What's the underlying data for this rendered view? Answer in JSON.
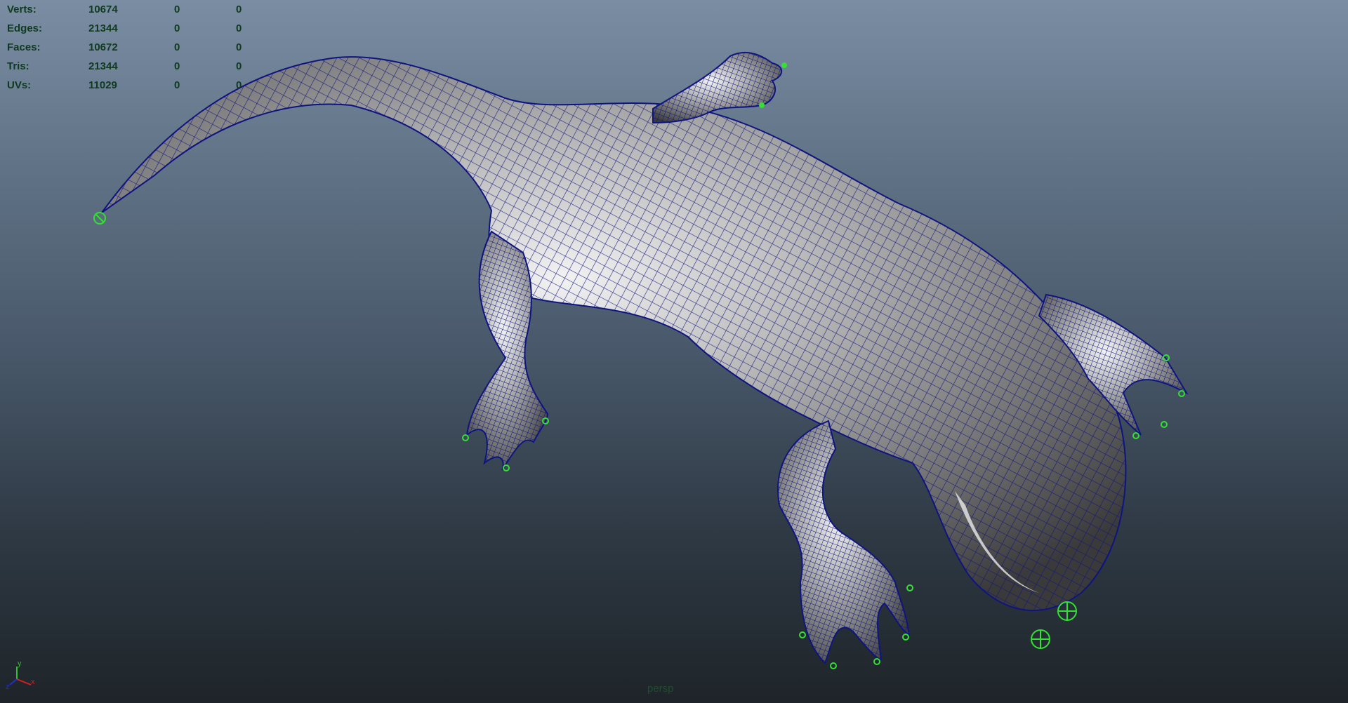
{
  "hud": {
    "rows": [
      {
        "label": "Verts:",
        "v1": "10674",
        "v2": "0",
        "v3": "0"
      },
      {
        "label": "Edges:",
        "v1": "21344",
        "v2": "0",
        "v3": "0"
      },
      {
        "label": "Faces:",
        "v1": "10672",
        "v2": "0",
        "v3": "0"
      },
      {
        "label": "Tris:",
        "v1": "21344",
        "v2": "0",
        "v3": "0"
      },
      {
        "label": "UVs:",
        "v1": "11029",
        "v2": "0",
        "v3": "0"
      }
    ]
  },
  "viewport": {
    "camera_label": "persp",
    "axis": {
      "x": "x",
      "y": "y",
      "z": "z"
    }
  },
  "colors": {
    "wireframe": "#0e1480",
    "joint": "#34e034",
    "hud_text": "#0f3a1f"
  },
  "scene": {
    "object": "lizard-mesh",
    "icons": [
      "joint-marker-icon",
      "locator-icon"
    ]
  }
}
